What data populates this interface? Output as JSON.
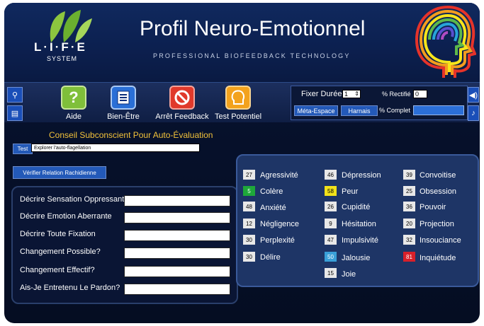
{
  "header": {
    "logo_text": "L·I·F·E",
    "logo_sub": "SYSTEM",
    "title": "Profil Neuro-Emotionnel",
    "subtitle": "PROFESSIONAL BIOFEEDBACK TECHNOLOGY"
  },
  "toolbar": {
    "tools": [
      {
        "label": "Aide",
        "icon": "question-icon",
        "color": "#7fbf3a"
      },
      {
        "label": "Bien-Être",
        "icon": "document-icon",
        "color": "#2a6fd6"
      },
      {
        "label": "Arrêt Feedback",
        "icon": "stop-icon",
        "color": "#e0392b"
      },
      {
        "label": "Test Potentiel",
        "icon": "head-icon",
        "color": "#f3a21d"
      }
    ],
    "fixer_duree_label": "Fixer Durée",
    "fixer_duree_value": "1",
    "rectifie_label": "% Rectifié",
    "rectifie_value": "0",
    "meta_espace_label": "Méta-Espace",
    "harnais_label": "Harnais",
    "complet_label": "% Complet"
  },
  "left_panel": {
    "title": "Conseil Subconscient Pour Auto-Évaluation",
    "test_button": "Test",
    "test_value": "Explorer l'auto-flagellation",
    "verify_button": "Vérifier Relation Rachidienne",
    "rows": [
      {
        "label": "Décrire Sensation Oppressante",
        "value": ""
      },
      {
        "label": "Décrire Emotion Aberrante",
        "value": ""
      },
      {
        "label": "Décrire Toute Fixation",
        "value": ""
      },
      {
        "label": "Changement Possible?",
        "value": ""
      },
      {
        "label": "Changement Effectif?",
        "value": ""
      },
      {
        "label": "Ais-Je Entretenu Le Pardon?",
        "value": ""
      }
    ]
  },
  "emotions": {
    "col1": [
      {
        "num": "27",
        "name": "Agressivité",
        "color": "#e8e8e8"
      },
      {
        "num": "5",
        "name": "Colère",
        "color": "#1ea83a"
      },
      {
        "num": "48",
        "name": "Anxiété",
        "color": "#e8e8e8"
      },
      {
        "num": "12",
        "name": "Négligence",
        "color": "#e8e8e8"
      },
      {
        "num": "30",
        "name": "Perplexité",
        "color": "#e8e8e8"
      },
      {
        "num": "30",
        "name": "Délire",
        "color": "#e8e8e8"
      }
    ],
    "col2": [
      {
        "num": "46",
        "name": "Dépression",
        "color": "#e8e8e8"
      },
      {
        "num": "58",
        "name": "Peur",
        "color": "#f2e21a"
      },
      {
        "num": "26",
        "name": "Cupidité",
        "color": "#e8e8e8"
      },
      {
        "num": "9",
        "name": "Hésitation",
        "color": "#e8e8e8"
      },
      {
        "num": "47",
        "name": "Impulsivité",
        "color": "#e8e8e8"
      },
      {
        "num": "50",
        "name": "Jalousie",
        "color": "#3aa0d8"
      },
      {
        "num": "15",
        "name": "Joie",
        "color": "#e8e8e8"
      }
    ],
    "col3": [
      {
        "num": "39",
        "name": "Convoitise",
        "color": "#e8e8e8"
      },
      {
        "num": "25",
        "name": "Obsession",
        "color": "#e8e8e8"
      },
      {
        "num": "36",
        "name": "Pouvoir",
        "color": "#e8e8e8"
      },
      {
        "num": "20",
        "name": "Projection",
        "color": "#e8e8e8"
      },
      {
        "num": "32",
        "name": "Insouciance",
        "color": "#e8e8e8"
      },
      {
        "num": "81",
        "name": "Inquiétude",
        "color": "#d8202a"
      }
    ]
  }
}
